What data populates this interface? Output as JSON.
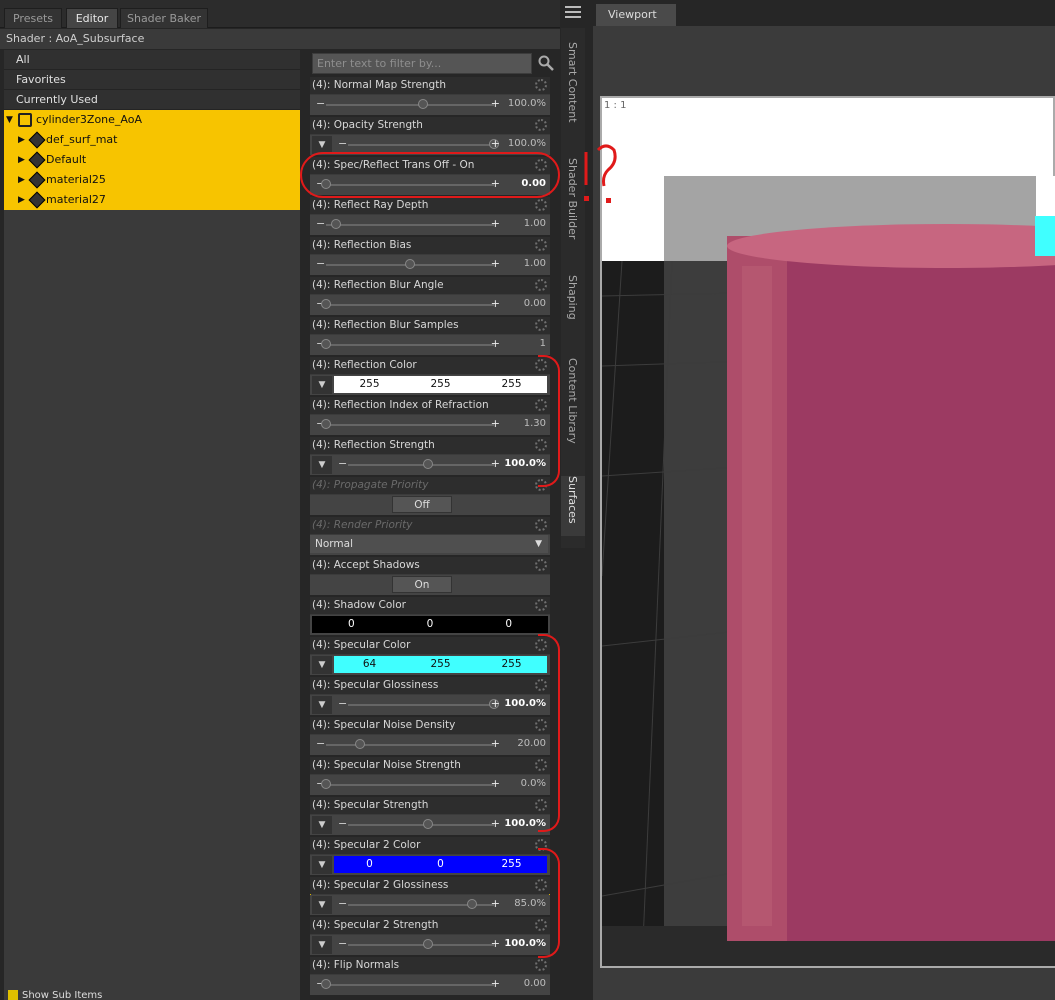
{
  "tabs": [
    "Presets",
    "Editor",
    "Shader Baker"
  ],
  "shader_title": "Shader : AoA_Subsurface",
  "left_nav": [
    "All",
    "Favorites",
    "Currently Used"
  ],
  "tree": {
    "root": "cylinder3Zone_AoA",
    "children": [
      "def_surf_mat",
      "Default",
      "material25",
      "material27"
    ]
  },
  "show_sub_items": "Show Sub Items",
  "filter_placeholder": "Enter text to filter by...",
  "viewport_tab": "Viewport",
  "viewport_zoom": "1 : 1",
  "side_tabs": [
    "Smart Content",
    "Shader Builder",
    "Shaping",
    "Content Library",
    "Surfaces"
  ],
  "properties": [
    {
      "label": "(4): Normal Map Strength",
      "kind": "slider",
      "value": "100.0%",
      "pos": 0.58
    },
    {
      "label": "(4): Opacity Strength",
      "kind": "slider-dd",
      "value": "100.0%",
      "pos": 1.0
    },
    {
      "label": "(4): Spec/Reflect Trans Off - On",
      "kind": "slider",
      "value": "0.00",
      "pos": 0.0,
      "bold": true
    },
    {
      "label": "(4): Reflect Ray Depth",
      "kind": "slider",
      "value": "1.00",
      "pos": 0.06
    },
    {
      "label": "(4): Reflection Bias",
      "kind": "slider",
      "value": "1.00",
      "pos": 0.5
    },
    {
      "label": "(4): Reflection Blur Angle",
      "kind": "slider",
      "value": "0.00",
      "pos": 0.0
    },
    {
      "label": "(4): Reflection Blur Samples",
      "kind": "slider",
      "value": "1",
      "pos": 0.0
    },
    {
      "label": "(4): Reflection Color",
      "kind": "color",
      "rgb": [
        "255",
        "255",
        "255"
      ],
      "bg": "#ffffff",
      "fg": "#111111"
    },
    {
      "label": "(4): Reflection Index of Refraction",
      "kind": "slider",
      "value": "1.30",
      "pos": 0.0
    },
    {
      "label": "(4): Reflection Strength",
      "kind": "slider-dd",
      "value": "100.0%",
      "pos": 0.55,
      "bold": true
    },
    {
      "label": "(4): Propagate Priority",
      "kind": "button",
      "value": "Off",
      "disabled": true
    },
    {
      "label": "(4): Render Priority",
      "kind": "combo",
      "value": "Normal",
      "disabled": true
    },
    {
      "label": "(4): Accept Shadows",
      "kind": "button",
      "value": "On"
    },
    {
      "label": "(4): Shadow Color",
      "kind": "fullcolor",
      "rgb": [
        "0",
        "0",
        "0"
      ],
      "bg": "#000000",
      "fg": "#ffffff"
    },
    {
      "label": "(4): Specular Color",
      "kind": "color",
      "rgb": [
        "64",
        "255",
        "255"
      ],
      "bg": "#40ffff",
      "fg": "#111111"
    },
    {
      "label": "(4): Specular Glossiness",
      "kind": "slider-dd",
      "value": "100.0%",
      "pos": 1.0,
      "bold": true
    },
    {
      "label": "(4): Specular Noise Density",
      "kind": "slider",
      "value": "20.00",
      "pos": 0.2
    },
    {
      "label": "(4): Specular Noise Strength",
      "kind": "slider",
      "value": "0.0%",
      "pos": 0.0
    },
    {
      "label": "(4): Specular Strength",
      "kind": "slider-dd",
      "value": "100.0%",
      "pos": 0.55,
      "bold": true
    },
    {
      "label": "(4): Specular 2 Color",
      "kind": "color",
      "rgb": [
        "0",
        "0",
        "255"
      ],
      "bg": "#0000ff",
      "fg": "#ffffff"
    },
    {
      "label": "(4): Specular 2 Glossiness",
      "kind": "slider-dd",
      "value": "85.0%",
      "pos": 0.85,
      "highlight": true
    },
    {
      "label": "(4): Specular 2 Strength",
      "kind": "slider-dd",
      "value": "100.0%",
      "pos": 0.55,
      "bold": true
    },
    {
      "label": "(4): Flip Normals",
      "kind": "slider",
      "value": "0.00",
      "pos": 0.0
    }
  ],
  "colors": {
    "tree_bg": "#f7c400",
    "annotation": "#e01a1a",
    "cylinder": "#9c3a62"
  }
}
